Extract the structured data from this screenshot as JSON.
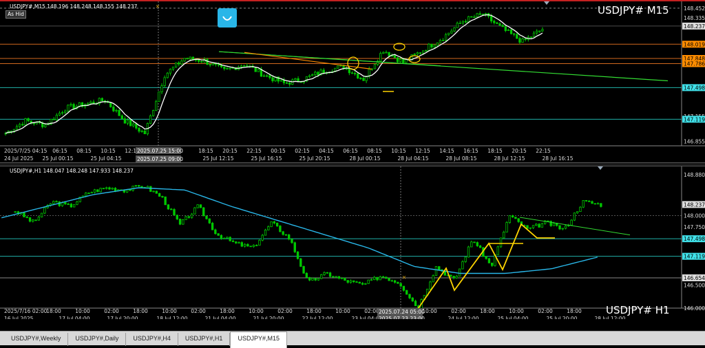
{
  "m15": {
    "info": "USDJPY#,M15  148.196 148.248 148.155 148.237",
    "symbol": "USDJPY# M15",
    "hide_button": "As Hid",
    "prices": [
      "148.452",
      "148.335",
      "148.237",
      "148.019",
      "147.848",
      "147.786",
      "147.498",
      "147.155",
      "147.119",
      "146.855"
    ],
    "time_labels": [
      "2025/7/25 04:15",
      "06:15",
      "08:15",
      "10:15",
      "12:15",
      "18:15",
      "20:15",
      "22:15",
      "00:15",
      "02:15",
      "04:15",
      "06:15",
      "08:15",
      "10:15",
      "12:15",
      "14:15",
      "16:15",
      "18:15",
      "20:15",
      "22:15"
    ],
    "date_labels": [
      "24 Jul 2025",
      "25 Jul 00:15",
      "25 Jul 04:15",
      "25 Jul 12:15",
      "25 Jul 16:15",
      "25 Jul 20:15",
      "28 Jul 00:15",
      "28 Jul 04:15",
      "28 Jul 08:15",
      "28 Jul 12:15",
      "28 Jul 16:15"
    ],
    "crosshair_time": "2025.07.25 15:00",
    "crosshair_time2": "2025.07.25 09:00"
  },
  "h1": {
    "info": "USDJPY#,H1  148.047 148.248 147.933 148.237",
    "symbol": "USDJPY# H1",
    "prices": [
      "148.880",
      "148.237",
      "148.000",
      "147.750",
      "147.498",
      "147.119",
      "146.654",
      "146.500",
      "146.000"
    ],
    "time_labels": [
      "2025/7/16 02:00",
      "18:00",
      "10:00",
      "02:00",
      "18:00",
      "10:00",
      "02:00",
      "18:00",
      "10:00",
      "02:00",
      "18:00",
      "10:00",
      "02:00",
      "18:00",
      "10:00",
      "02:00",
      "18:00",
      "10:00",
      "02:00",
      "18:00"
    ],
    "date_labels": [
      "16 Jul 2025",
      "17 Jul 04:00",
      "17 Jul 20:00",
      "18 Jul 12:00",
      "21 Jul 04:00",
      "21 Jul 20:00",
      "22 Jul 12:00",
      "23 Jul 04:00",
      "24 Jul 12:00",
      "25 Jul 04:00",
      "25 Jul 20:00",
      "28 Jul 12:00"
    ],
    "crosshair_time": "2025.07.24 05:00",
    "crosshair_time2": "2025.07.23 23:00"
  },
  "tabs": [
    "USDJPY#,Weekly",
    "USDJPY#,Daily",
    "USDJPY#,H4",
    "USDJPY#,H1",
    "USDJPY#,M15"
  ],
  "active_tab": "USDJPY#,M15",
  "colors": {
    "candle": "#00c800",
    "ma_white": "#ffffff",
    "ma_cyan": "#29b6e8",
    "trend_green": "#33dd33",
    "trend_orange": "#ff8c00",
    "hline_orange": "#d2691e",
    "hline_cyan": "#20b2aa",
    "yellow": "#ffd400"
  }
}
